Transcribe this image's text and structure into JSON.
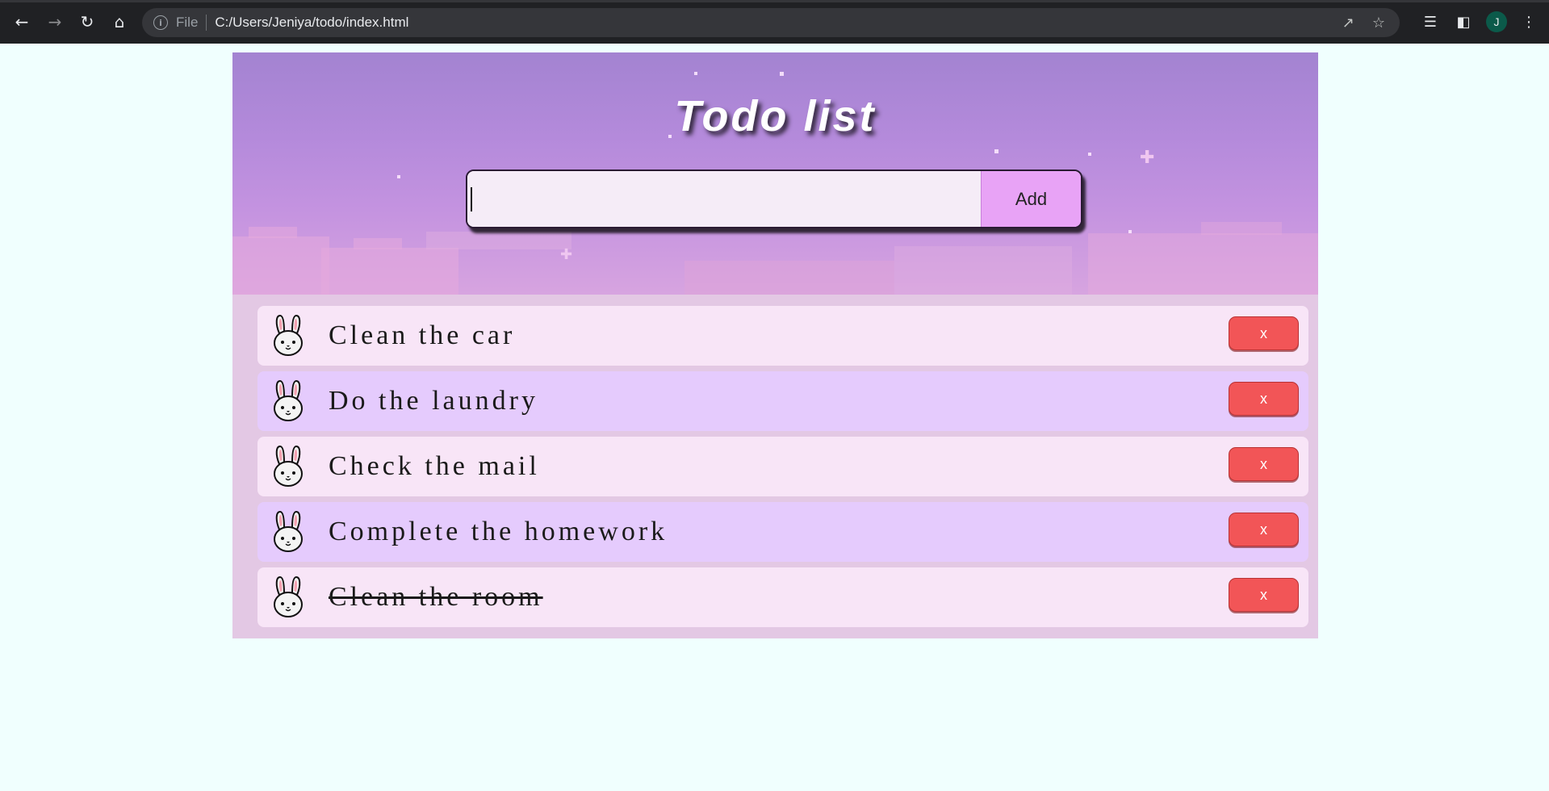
{
  "browser": {
    "scheme_label": "File",
    "url": "C:/Users/Jeniya/todo/index.html",
    "avatar_initial": "J",
    "accent": "#0b5a4a"
  },
  "app": {
    "title": "Todo list",
    "input": {
      "value": "",
      "placeholder": ""
    },
    "add_label": "Add",
    "colors": {
      "odd_row": "#f8e5f7",
      "even_row": "#e5cbfd",
      "delete": "#f25557",
      "add": "#e8a3f6"
    }
  },
  "todos": [
    {
      "text": "Clean the car",
      "done": false,
      "delete_label": "x",
      "icon": "bunny-icon"
    },
    {
      "text": "Do the laundry",
      "done": false,
      "delete_label": "x",
      "icon": "bunny-icon"
    },
    {
      "text": "Check the mail",
      "done": false,
      "delete_label": "x",
      "icon": "bunny-icon"
    },
    {
      "text": "Complete the homework",
      "done": false,
      "delete_label": "x",
      "icon": "bunny-icon"
    },
    {
      "text": "Clean the room",
      "done": true,
      "delete_label": "x",
      "icon": "bunny-icon"
    }
  ]
}
